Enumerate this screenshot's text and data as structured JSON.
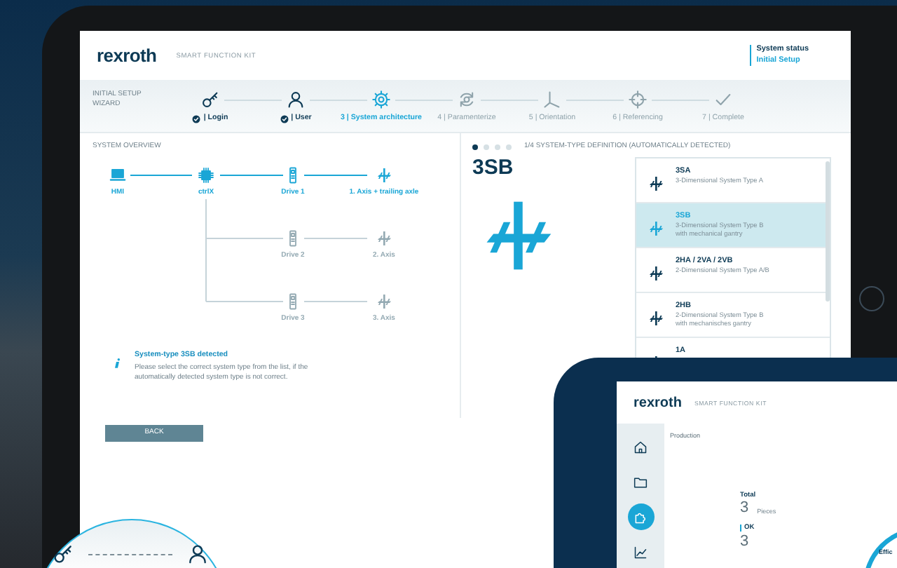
{
  "header": {
    "logo": "rexroth",
    "product": "SMART FUNCTION KIT",
    "status_label": "System status",
    "status_value": "Initial Setup"
  },
  "wizard": {
    "title": "INITIAL SETUP WIZARD",
    "steps": [
      {
        "label": "| Login",
        "completed": true,
        "selected": false
      },
      {
        "label": "| User",
        "completed": true,
        "selected": false
      },
      {
        "label": "3 | System architecture",
        "completed": false,
        "selected": true
      },
      {
        "label": "4 | Paramenterize",
        "completed": false,
        "selected": false
      },
      {
        "label": "5 | Orientation",
        "completed": false,
        "selected": false
      },
      {
        "label": "6 | Referencing",
        "completed": false,
        "selected": false
      },
      {
        "label": "7 | Complete",
        "completed": false,
        "selected": false
      }
    ]
  },
  "overview": {
    "title": "SYSTEM OVERVIEW",
    "hmi": "HMI",
    "controller": "ctrlX",
    "branches": [
      {
        "drive": "Drive 1",
        "axis": "1. Axis + trailing axle",
        "active": true
      },
      {
        "drive": "Drive 2",
        "axis": "2. Axis",
        "active": false
      },
      {
        "drive": "Drive 3",
        "axis": "3. Axis",
        "active": false
      }
    ]
  },
  "info": {
    "title": "System-type 3SB detected",
    "text": "Please select the correct system type from the list, if the automatically detected system type is not correct."
  },
  "back_button": "BACK",
  "definition": {
    "pages": [
      {
        "selected": true
      },
      {
        "selected": false
      },
      {
        "selected": false
      },
      {
        "selected": false
      }
    ],
    "heading": "1/4 SYSTEM-TYPE DEFINITION (AUTOMATICALLY DETECTED)",
    "current": "3SB",
    "types": [
      {
        "code": "3SA",
        "description": [
          "3-Dimensional System Type A"
        ],
        "selected": false
      },
      {
        "code": "3SB",
        "description": [
          "3-Dimensional System Type B",
          "with mechanical gantry"
        ],
        "selected": true
      },
      {
        "code": "2HA / 2VA / 2VB",
        "description": [
          "2-Dimensional System Type A/B"
        ],
        "selected": false
      },
      {
        "code": "2HB",
        "description": [
          "2-Dimensional System Type B",
          "with mechanisches gantry"
        ],
        "selected": false
      },
      {
        "code": "1A",
        "selected": false
      }
    ]
  },
  "production_tablet": {
    "logo": "rexroth",
    "product": "SMART FUNCTION KIT",
    "nav": [
      {
        "selected": false
      },
      {
        "selected": false
      },
      {
        "selected": true
      },
      {
        "selected": false
      }
    ],
    "page_title": "Production",
    "total_label": "Total",
    "total_value": "3",
    "total_unit": "Pieces",
    "ok_label": "OK",
    "ok_value": "3",
    "gauge_label": "Effic"
  }
}
